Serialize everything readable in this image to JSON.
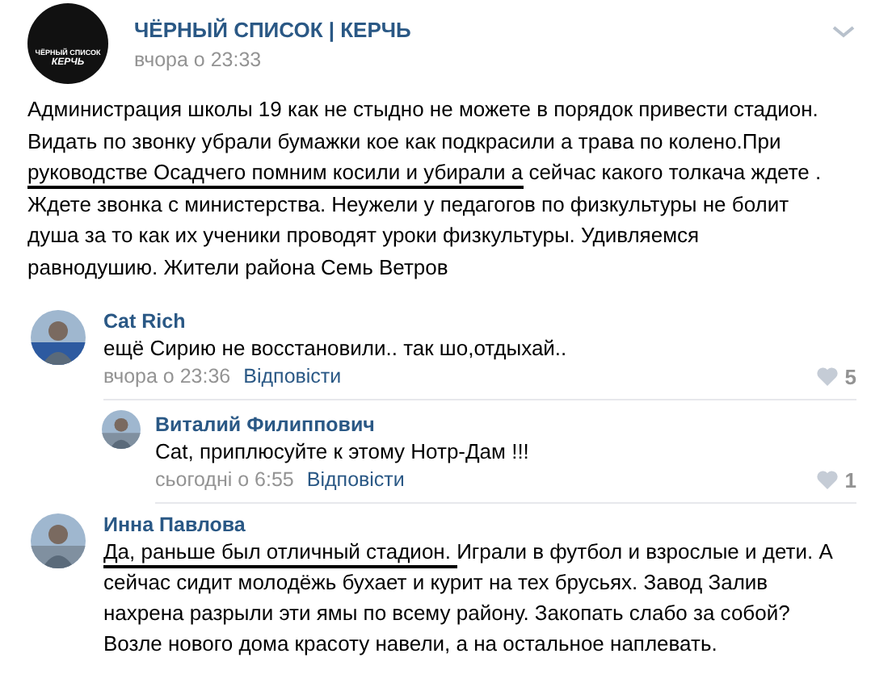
{
  "post": {
    "author": "ЧЁРНЫЙ СПИСОК | КЕРЧЬ",
    "time": "вчора о 23:33",
    "logo_lines": [
      "ЧЁРНЫЙ СПИСОК",
      "КЕРЧЬ"
    ],
    "lines": [
      [
        {
          "text": "Администрация школы 19 как не стыдно не можете в порядок привести стадион.",
          "marked": false
        }
      ],
      [
        {
          "text": "Видать по звонку убрали бумажки кое как подкрасили а трава по колено.При",
          "marked": false
        }
      ],
      [
        {
          "text": "руководстве Осадчего помним косили и убирали а",
          "marked": true
        },
        {
          "text": " сейчас какого толкача ждете .",
          "marked": false
        }
      ],
      [
        {
          "text": "Ждете звонка с министерства. Неужели у педагогов по физкультуры не болит",
          "marked": false
        }
      ],
      [
        {
          "text": "душа за то как их ученики проводят уроки физкультуры. Удивляемся",
          "marked": false
        }
      ],
      [
        {
          "text": "равнодушию. Жители района Семь Ветров",
          "marked": false
        }
      ]
    ]
  },
  "comments": [
    {
      "kind": "top",
      "author": "Cat Rich",
      "lines": [
        [
          {
            "text": "ещё Сирию не восстановили.. так шо,отдыхай..",
            "marked": false
          }
        ]
      ],
      "time": "вчора о 23:36",
      "reply": "Відповісти",
      "likes": "5"
    },
    {
      "kind": "nested",
      "author": "Виталий Филиппович",
      "lines": [
        [
          {
            "text": "Cat, приплюсуйте к этому Нотр-Дам !!!",
            "marked": false
          }
        ]
      ],
      "time": "сьогодні о 6:55",
      "reply": "Відповісти",
      "likes": "1"
    },
    {
      "kind": "top",
      "author": "Инна Павлова",
      "lines": [
        [
          {
            "text": "Да, раньше был отличный стадион. ",
            "marked": true
          },
          {
            "text": "Играли в футбол и взрослые и дети. А",
            "marked": false
          }
        ],
        [
          {
            "text": "сейчас сидит молодёжь бухает и курит на тех брусьях. Завод Залив",
            "marked": false
          }
        ],
        [
          {
            "text": "нахрена разрыли эти ямы по всему району. Закопать слабо за собой?",
            "marked": false
          }
        ],
        [
          {
            "text": "Возле нового дома красоту навели, а на остальное наплевать.",
            "marked": false
          }
        ]
      ]
    }
  ]
}
